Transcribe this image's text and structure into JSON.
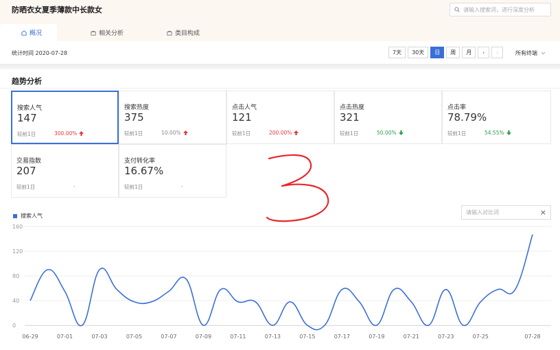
{
  "header": {
    "keyword_title": "防晒衣女夏季薄款中长款女",
    "search_placeholder": "请输入搜索词，进行深度分析",
    "tabs": [
      {
        "label": "概况",
        "active": true
      },
      {
        "label": "相关分析",
        "active": false
      },
      {
        "label": "类目构成",
        "active": false
      }
    ]
  },
  "toolbar": {
    "stat_date": "统计时间 2020-07-28",
    "periods": [
      {
        "label": "7天",
        "active": false
      },
      {
        "label": "30天",
        "active": false
      },
      {
        "label": "日",
        "active": true
      },
      {
        "label": "周",
        "active": false
      },
      {
        "label": "月",
        "active": false
      }
    ],
    "prev_glyph": "‹",
    "next_glyph": "›",
    "channel": "所有终端"
  },
  "section": {
    "title": "趋势分析"
  },
  "metrics": [
    {
      "label": "搜索人气",
      "value": "147",
      "compare": "较前1日",
      "change": "300.00%",
      "direction": "up",
      "selected": true
    },
    {
      "label": "搜索热度",
      "value": "375",
      "compare": "较前1日",
      "change": "10.00%",
      "direction": "up",
      "selected": false
    },
    {
      "label": "点击人气",
      "value": "121",
      "compare": "较前1日",
      "change": "200.00%",
      "direction": "up",
      "selected": false
    },
    {
      "label": "点击热度",
      "value": "321",
      "compare": "较前1日",
      "change": "50.00%",
      "direction": "down",
      "selected": false
    },
    {
      "label": "点击率",
      "value": "78.79%",
      "compare": "较前1日",
      "change": "54.55%",
      "direction": "down",
      "selected": false
    },
    {
      "label": "交易指数",
      "value": "207",
      "compare": "较前1日",
      "change": "-",
      "direction": "none",
      "selected": false
    },
    {
      "label": "支付转化率",
      "value": "16.67%",
      "compare": "较前1日",
      "change": "-",
      "direction": "none",
      "selected": false
    }
  ],
  "compare_input": {
    "placeholder": "请输入对比词",
    "close_glyph": "×"
  },
  "colors": {
    "accent": "#3a6fd8",
    "up": "#e4393c",
    "down": "#2a9d4a",
    "annotation": "#e8262a"
  },
  "chart_data": {
    "type": "line",
    "legend": "搜索人气",
    "ylim": [
      0,
      160
    ],
    "y_ticks": [
      0,
      40,
      80,
      120,
      160
    ],
    "x": [
      "06-29",
      "06-30",
      "07-01",
      "07-02",
      "07-03",
      "07-04",
      "07-05",
      "07-06",
      "07-07",
      "07-08",
      "07-09",
      "07-10",
      "07-11",
      "07-12",
      "07-13",
      "07-14",
      "07-15",
      "07-16",
      "07-17",
      "07-18",
      "07-19",
      "07-20",
      "07-21",
      "07-22",
      "07-23",
      "07-24",
      "07-25",
      "07-26",
      "07-27",
      "07-28"
    ],
    "x_tick_labels": [
      "06-29",
      "07-01",
      "07-03",
      "07-05",
      "07-07",
      "07-09",
      "07-11",
      "07-13",
      "07-15",
      "07-17",
      "07-19",
      "07-21",
      "07-23",
      "07-25",
      "07-28"
    ],
    "series": [
      {
        "name": "搜索人气",
        "values": [
          40,
          90,
          55,
          0,
          90,
          58,
          38,
          38,
          55,
          75,
          0,
          58,
          38,
          38,
          0,
          38,
          0,
          0,
          58,
          38,
          0,
          58,
          38,
          0,
          58,
          0,
          38,
          58,
          58,
          147
        ]
      }
    ],
    "grid": true
  }
}
